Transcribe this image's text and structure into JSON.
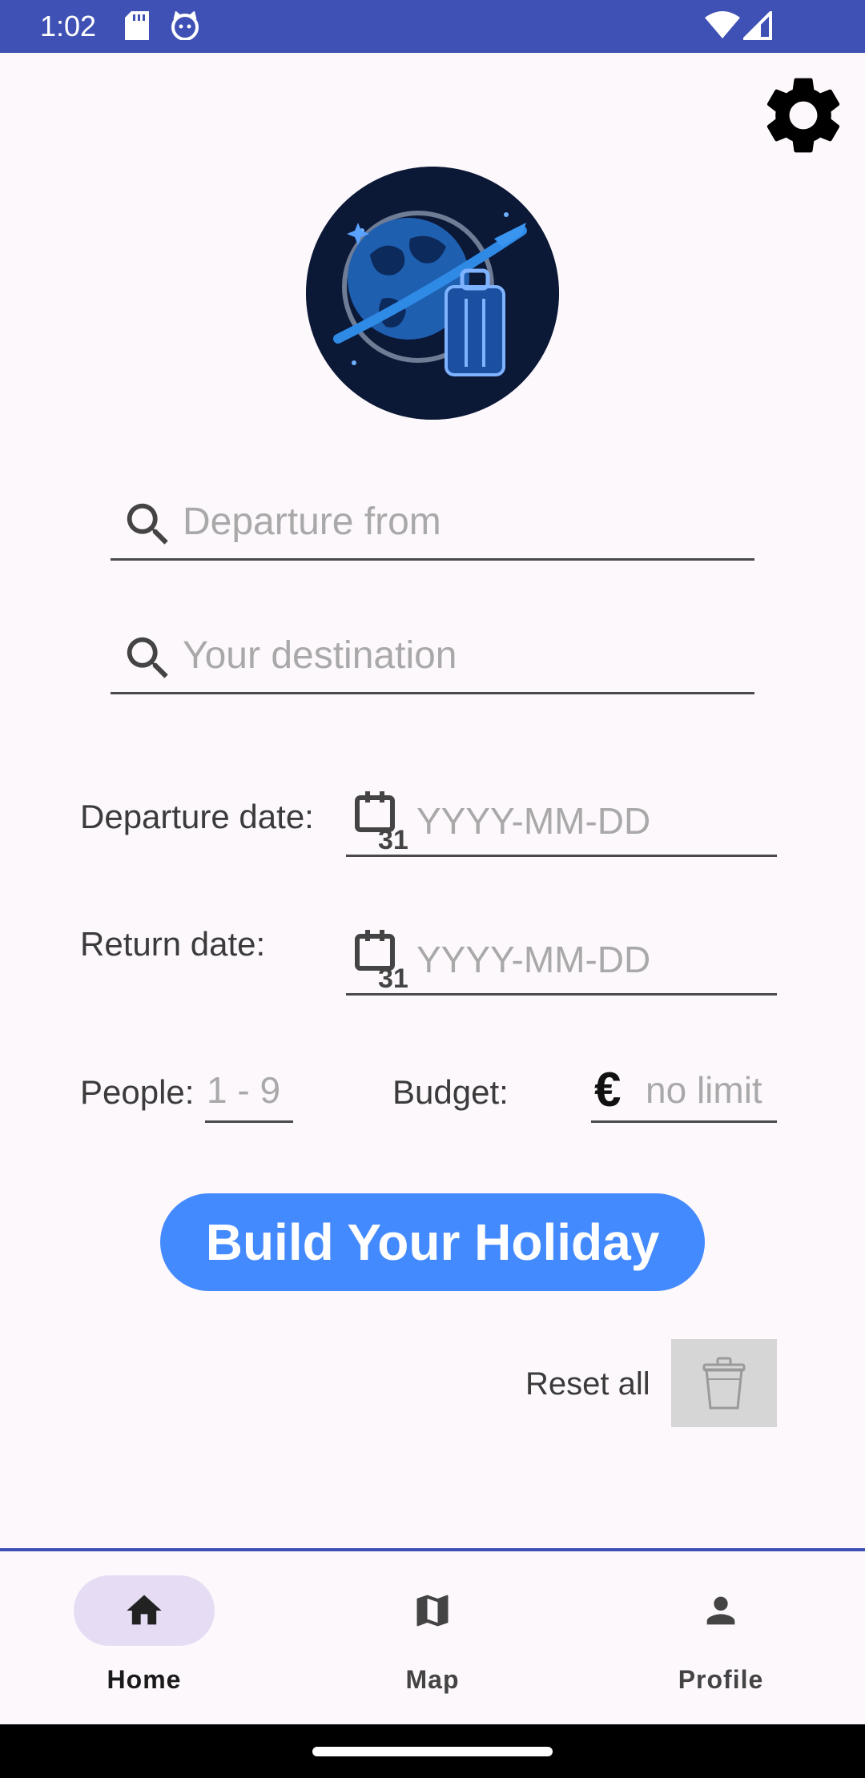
{
  "status_bar": {
    "time": "1:02",
    "icons": [
      "sd-card-icon",
      "cat-icon",
      "wifi-icon",
      "signal-icon"
    ],
    "background": "#3f51b5"
  },
  "header": {
    "settings_icon": "gear-icon"
  },
  "logo": {
    "icon": "travel-globe-suitcase-logo"
  },
  "form": {
    "departure_from": {
      "placeholder": "Departure from",
      "icon": "search-icon"
    },
    "destination": {
      "placeholder": "Your destination",
      "icon": "search-icon"
    },
    "departure_date": {
      "label": "Departure date:",
      "placeholder": "YYYY-MM-DD",
      "icon": "calendar-icon"
    },
    "return_date": {
      "label": "Return date:",
      "placeholder": "YYYY-MM-DD",
      "icon": "calendar-icon"
    },
    "people": {
      "label": "People:",
      "placeholder": "1 - 9"
    },
    "budget": {
      "label": "Budget:",
      "placeholder": "no limit",
      "currency_symbol": "€"
    }
  },
  "actions": {
    "build_label": "Build Your Holiday",
    "build_color": "#448aff",
    "reset_label": "Reset all",
    "reset_icon": "trash-icon"
  },
  "bottom_nav": {
    "items": [
      {
        "label": "Home",
        "icon": "home-icon",
        "active": true
      },
      {
        "label": "Map",
        "icon": "map-icon",
        "active": false
      },
      {
        "label": "Profile",
        "icon": "person-icon",
        "active": false
      }
    ],
    "active_pill_color": "#e6ddf5"
  }
}
